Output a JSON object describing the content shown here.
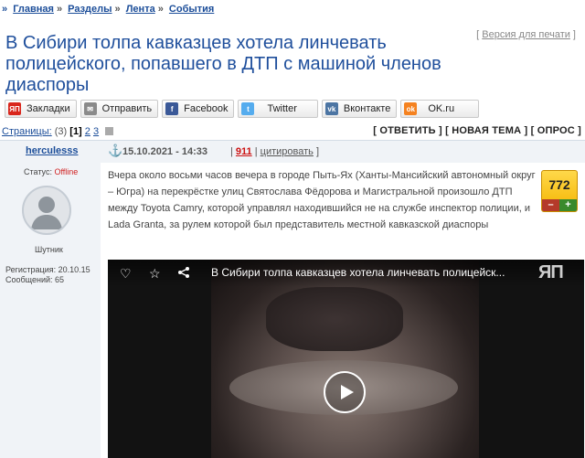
{
  "breadcrumb": {
    "arrow": "»",
    "items": [
      "Главная",
      "Разделы",
      "Лента",
      "События"
    ],
    "separator": "»"
  },
  "post": {
    "title": "В Сибири толпа кавказцев хотела линчевать полицейского, попавшего в ДТП с машиной членов диаспоры",
    "print_version": "Версия для печати"
  },
  "share_buttons": [
    {
      "label": "Закладки",
      "icon": "yaplakal-icon",
      "color": "#d9261c",
      "glyph": "ЯП"
    },
    {
      "label": "Отправить",
      "icon": "mail-icon",
      "color": "#8a8a8a",
      "glyph": "✉"
    },
    {
      "label": "Facebook",
      "icon": "facebook-icon",
      "color": "#3b5998",
      "glyph": "f"
    },
    {
      "label": "Twitter",
      "icon": "twitter-icon",
      "color": "#55acee",
      "glyph": "t"
    },
    {
      "label": "Вконтакте",
      "icon": "vk-icon",
      "color": "#4c75a3",
      "glyph": "vk"
    },
    {
      "label": "OK.ru",
      "icon": "ok-icon",
      "color": "#f58220",
      "glyph": "ok"
    }
  ],
  "pagination": {
    "label": "Страницы:",
    "count": "(3)",
    "current": "[1]",
    "pages": [
      "2",
      "3"
    ]
  },
  "actions": "[ ОТВЕТИТЬ ] [ НОВАЯ ТЕМА ] [ ОПРОС ]",
  "author": {
    "name": "herculesss",
    "status_label": "Статус:",
    "status_value": "Offline",
    "rank": "Шутник",
    "registration": "Регистрация: 20.10.15",
    "messages": "Сообщений: 65"
  },
  "meta": {
    "date": "15.10.2021 - 14:33",
    "number": "911",
    "quote": "цитировать"
  },
  "body_text": "Вчера около восьми часов вечера в городе Пыть-Ях (Ханты-Мансийский автономный округ – Югра) на перекрёстке улиц Святослава Фёдорова и Магистральной произошло ДТП между Toyota Camry, которой управлял находившийся не на службе инспектор полиции, и Lada Granta, за рулем которой был представитель местной кавказской диаспоры",
  "rating": {
    "value": "772",
    "minus": "–",
    "plus": "+"
  },
  "video": {
    "title": "В Сибири толпа кавказцев хотела линчевать полицейск...",
    "logo": "ЯП"
  },
  "colors": {
    "link": "#1b4d99",
    "title": "#1f4f9c",
    "offline": "#d02020",
    "rating": "#f4b400"
  }
}
